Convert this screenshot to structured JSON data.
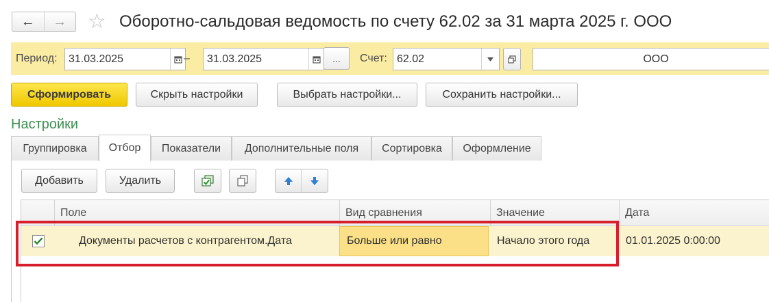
{
  "window": {
    "title": "Оборотно-сальдовая ведомость по счету 62.02 за 31 марта 2025 г. ООО",
    "nav_back": "back-arrow-icon",
    "nav_forward": "forward-arrow-icon",
    "favorite": "star-icon"
  },
  "period_bar": {
    "period_label": "Период:",
    "date_from": "31.03.2025",
    "dash": "–",
    "date_to": "31.03.2025",
    "ellipsis_label": "...",
    "account_label": "Счет:",
    "account_value": "62.02",
    "organization_value": "ООО"
  },
  "toolbar": {
    "generate": "Сформировать",
    "hide_settings": "Скрыть настройки",
    "choose_settings": "Выбрать настройки...",
    "save_settings": "Сохранить настройки..."
  },
  "settings": {
    "title": "Настройки",
    "tabs": [
      "Группировка",
      "Отбор",
      "Показатели",
      "Дополнительные поля",
      "Сортировка",
      "Оформление"
    ],
    "active_tab": "Отбор"
  },
  "filter_toolbar": {
    "add": "Добавить",
    "delete": "Удалить",
    "icons": [
      "check-all-icon",
      "copy-icon",
      "move-up-icon",
      "move-down-icon"
    ]
  },
  "grid": {
    "columns": [
      "Поле",
      "Вид сравнения",
      "Значение",
      "Дата"
    ],
    "rows": [
      {
        "checked": true,
        "field": "Документы расчетов с контрагентом.Дата",
        "comparison": "Больше или равно",
        "value": "Начало этого года",
        "date": "01.01.2025 0:00:00"
      }
    ]
  },
  "colors": {
    "accent_yellow": "#f0c800",
    "period_bar_bg": "#fbeca4",
    "section_green": "#3d8f52",
    "highlight_red": "#d81e2a",
    "row_bg": "#fbf3cd"
  }
}
